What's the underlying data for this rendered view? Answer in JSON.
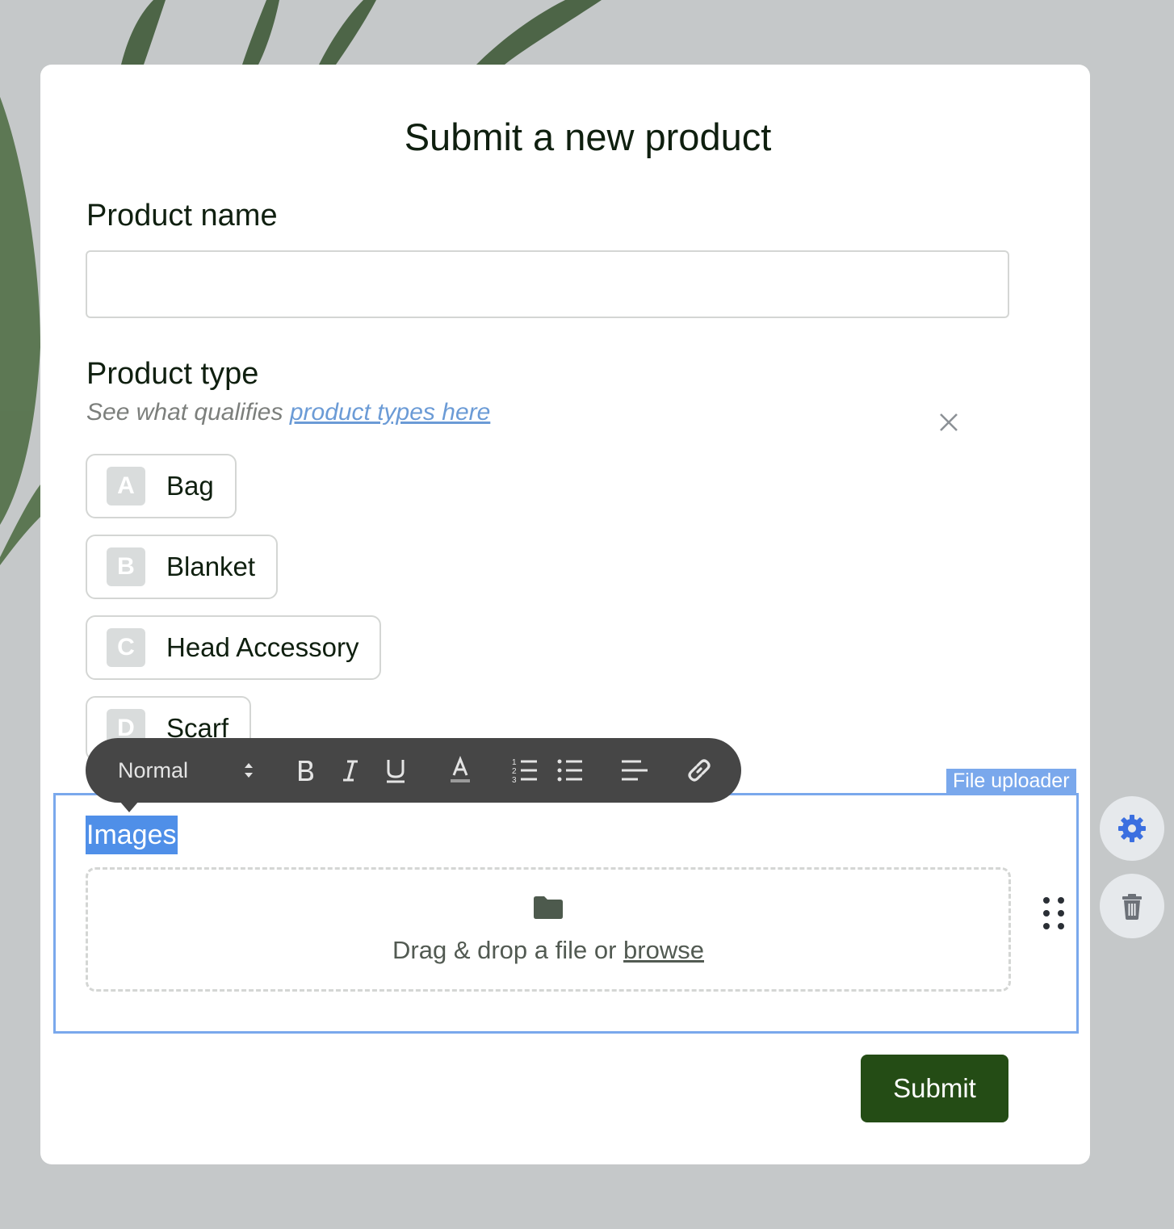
{
  "form": {
    "title": "Submit a new product",
    "product_name": {
      "label": "Product name",
      "value": ""
    },
    "product_type": {
      "label": "Product type",
      "helper_prefix": "See what qualifies ",
      "helper_link": "product types here",
      "choices": [
        {
          "key": "A",
          "label": "Bag"
        },
        {
          "key": "B",
          "label": "Blanket"
        },
        {
          "key": "C",
          "label": "Head Accessory"
        },
        {
          "key": "D",
          "label": "Scarf"
        }
      ]
    },
    "images": {
      "label": "Images",
      "block_tag": "File uploader",
      "drop_prefix": "Drag & drop a file or ",
      "drop_link": "browse"
    },
    "submit_label": "Submit"
  },
  "toolbar": {
    "text_style": "Normal",
    "buttons": [
      "bold-icon",
      "italic-icon",
      "underline-icon",
      "text-color-icon",
      "ordered-list-icon",
      "bullet-list-icon",
      "align-left-icon",
      "link-icon"
    ]
  },
  "side_actions": [
    "gear-icon",
    "trash-icon"
  ],
  "colors": {
    "brand_green": "#244c15",
    "selection_blue": "#4f8fe8",
    "frame_blue": "#7aa8ec",
    "link_blue": "#6b9bd6",
    "toolbar_bg": "#464646",
    "settings_icon_blue": "#3b6fe0"
  }
}
